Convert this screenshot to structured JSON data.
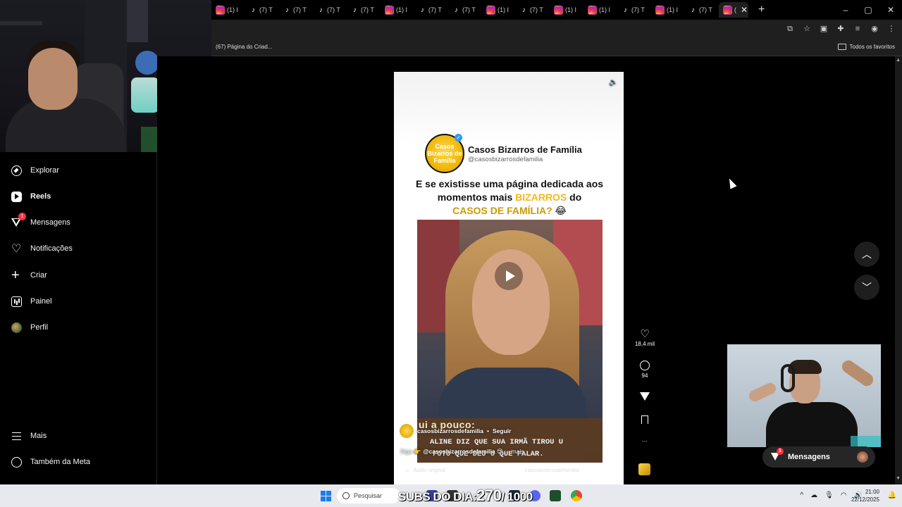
{
  "browser": {
    "tabs": [
      {
        "icon": "instagram-icon",
        "label": "(1) I"
      },
      {
        "icon": "tiktok-icon",
        "label": "(7) T"
      },
      {
        "icon": "tiktok-icon",
        "label": "(7) T"
      },
      {
        "icon": "tiktok-icon",
        "label": "(7) T"
      },
      {
        "icon": "tiktok-icon",
        "label": "(7) T"
      },
      {
        "icon": "instagram-icon",
        "label": "(1) I"
      },
      {
        "icon": "tiktok-icon",
        "label": "(7) T"
      },
      {
        "icon": "tiktok-icon",
        "label": "(7) T"
      },
      {
        "icon": "instagram-icon",
        "label": "(1) I"
      },
      {
        "icon": "tiktok-icon",
        "label": "(7) T"
      },
      {
        "icon": "instagram-icon",
        "label": "(1) I"
      },
      {
        "icon": "instagram-icon",
        "label": "(1) I"
      },
      {
        "icon": "tiktok-icon",
        "label": "(7) T"
      },
      {
        "icon": "instagram-icon",
        "label": "(1) I"
      },
      {
        "icon": "tiktok-icon",
        "label": "(7) T"
      }
    ],
    "active_tab_label": "(",
    "new_tab": "+",
    "window_controls": {
      "minimize": "–",
      "maximize": "▢",
      "close": "✕"
    },
    "bookmark_left": "(67) Página do Criad...",
    "bookmark_right": "Todos os favoritos"
  },
  "sidebar": {
    "items": [
      {
        "name": "explore",
        "icon": "compass-icon",
        "label": "Explorar"
      },
      {
        "name": "reels",
        "icon": "reels-icon",
        "label": "Reels"
      },
      {
        "name": "messages",
        "icon": "send-icon",
        "label": "Mensagens",
        "badge": "1"
      },
      {
        "name": "notifications",
        "icon": "heart-icon",
        "label": "Notificações"
      },
      {
        "name": "create",
        "icon": "plus-icon",
        "label": "Criar"
      },
      {
        "name": "dashboard",
        "icon": "chart-icon",
        "label": "Painel"
      },
      {
        "name": "profile",
        "icon": "avatar-icon",
        "label": "Perfil"
      }
    ],
    "more_label": "Mais",
    "meta_label": "Também da Meta"
  },
  "reel": {
    "account_name": "Casos Bizarros de Família",
    "account_handle": "@casosbizarrosdefamilia",
    "logo_text": "Casos Bizarros de Família",
    "headline_part1": "E se existisse uma página dedicada aos momentos mais ",
    "headline_highlight1": "BIZARROS",
    "headline_part2": " do ",
    "headline_highlight2": "CASOS DE FAMÍLIA?",
    "headline_emoji": " 😂",
    "video_caption_top": "ui a pouco:",
    "video_caption_line1": "ALINE DIZ QUE SUA IRMÃ TIROU U",
    "video_caption_line2": "FOTO QUE DEU O QUE FALAR.",
    "author": "casosbizarrosdefamilia",
    "follow": "Seguir",
    "description_prefix": "Siga 👉 ",
    "description_mention": "@casosbizarrosdefamilia",
    "description_suffix": " 😍 ... mais",
    "audio_label": "Áudio original",
    "audio_right": "casosbizarrosdefamilia"
  },
  "actions": {
    "likes": "18,4 mil",
    "comments": "94",
    "more": "···"
  },
  "messages_pill": {
    "label": "Mensagens",
    "badge": "1"
  },
  "taskbar": {
    "search_placeholder": "Pesquisar",
    "subs_prefix": "SUBS DO DIA:",
    "subs_value": "270",
    "subs_suffix": "/ 1000",
    "time": "21:00",
    "date": "22/12/2025"
  }
}
